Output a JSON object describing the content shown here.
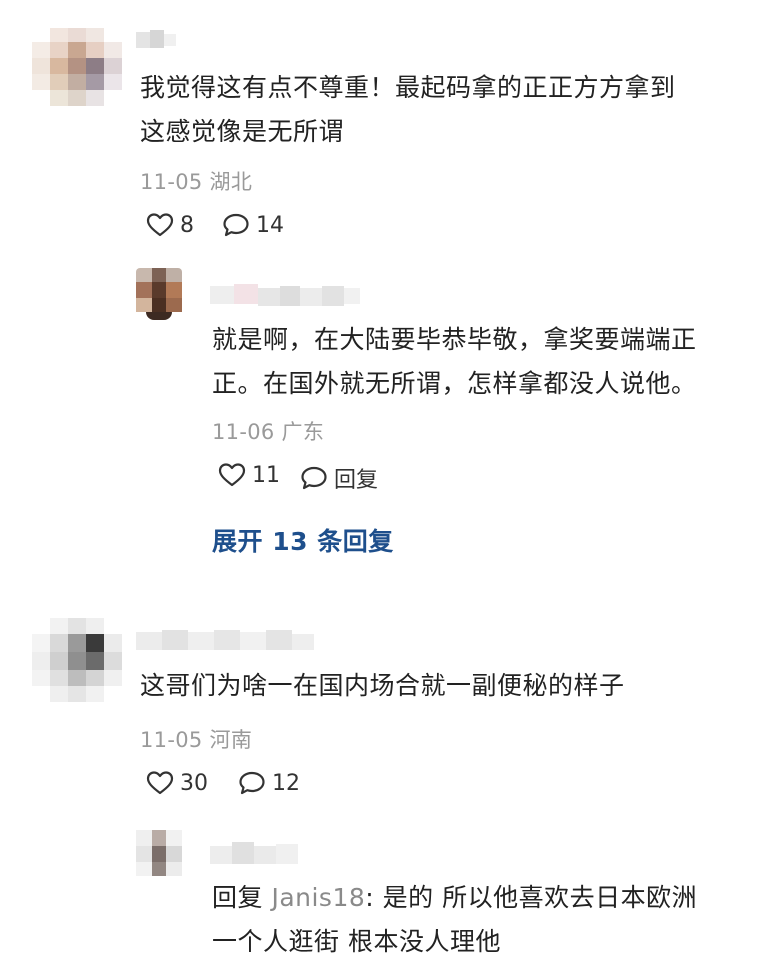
{
  "comments": [
    {
      "text": "我觉得这有点不尊重！最起码拿的正正方方拿到这感觉像是无所谓",
      "line1": "我觉得这有点不尊重！最起码拿的正正方方拿到",
      "line2": "这感觉像是无所谓",
      "date": "11-05",
      "location": "湖北",
      "likes": "8",
      "replies": "14",
      "reply": {
        "line1": "就是啊，在大陆要毕恭毕敬，拿奖要端端正",
        "line2": "正。在国外就无所谓，怎样拿都没人说他。",
        "date": "11-06",
        "location": "广东",
        "likes": "11",
        "reply_label": "回复"
      },
      "expand_label": "展开 13 条回复"
    },
    {
      "text": "这哥们为啥一在国内场合就一副便秘的样子",
      "date": "11-05",
      "location": "河南",
      "likes": "30",
      "replies": "12",
      "reply": {
        "prefix": "回复 ",
        "mention": "Janis18",
        "line1_rest": ": 是的 所以他喜欢去日本欧洲",
        "line2": "一个人逛街 根本没人理他"
      }
    }
  ],
  "icons": {
    "like": "heart-icon",
    "comment": "comment-bubble-icon"
  },
  "colors": {
    "text": "#222222",
    "meta": "#9a9a9a",
    "link": "#1e4f8c"
  }
}
